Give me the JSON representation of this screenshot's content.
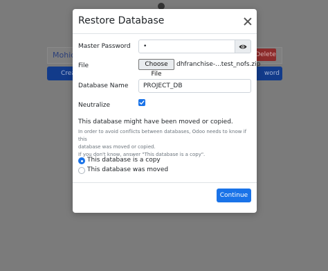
{
  "background": {
    "db_name": "Mohido",
    "delete_label": "Delete",
    "create_label": "Crea",
    "password_label": "word"
  },
  "modal": {
    "title": "Restore Database",
    "master_password": {
      "label": "Master Password",
      "value": "•"
    },
    "file": {
      "label": "File",
      "button": "Choose File",
      "filename": "dhfranchise-...test_nofs.zip"
    },
    "database_name": {
      "label": "Database Name",
      "value": "PROJECT_DB"
    },
    "neutralize": {
      "label": "Neutralize",
      "checked": true
    },
    "moved_or_copied": {
      "title": "This database might have been moved or copied.",
      "help_line_1": "In order to avoid conflicts between databases, Odoo needs to know if this",
      "help_line_2": "database was moved or copied.",
      "help_line_3": "If you don't know, answer \"This database is a copy\".",
      "options": [
        {
          "label": "This database is a copy",
          "selected": true
        },
        {
          "label": "This database was moved",
          "selected": false
        }
      ]
    },
    "continue_label": "Continue"
  },
  "colors": {
    "primary": "#1a73e8",
    "backdrop": "#7b7b7b"
  }
}
